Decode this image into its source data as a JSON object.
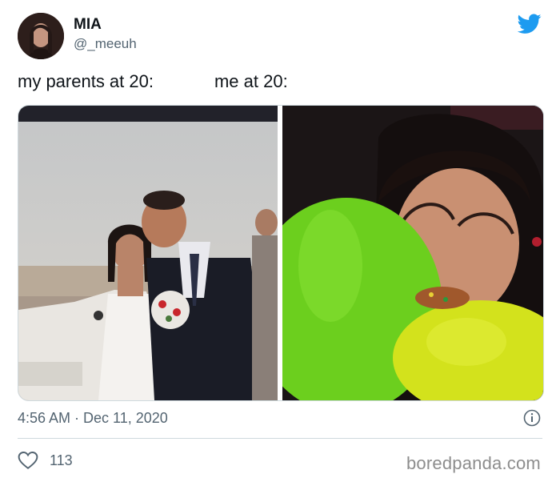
{
  "author": {
    "display_name": "MIA",
    "handle": "@_meeuh"
  },
  "tweet": {
    "caption_left": "my parents at 20:",
    "caption_right": "me at 20:",
    "timestamp": "4:56 AM · Dec 11, 2020",
    "like_count": "113"
  },
  "icons": {
    "platform": "twitter-bird-icon",
    "info": "info-icon",
    "like": "heart-icon"
  },
  "colors": {
    "twitter_blue": "#1d9bf0",
    "secondary_text": "#536471",
    "divider": "#cfd9de"
  },
  "watermark": "boredpanda.com"
}
